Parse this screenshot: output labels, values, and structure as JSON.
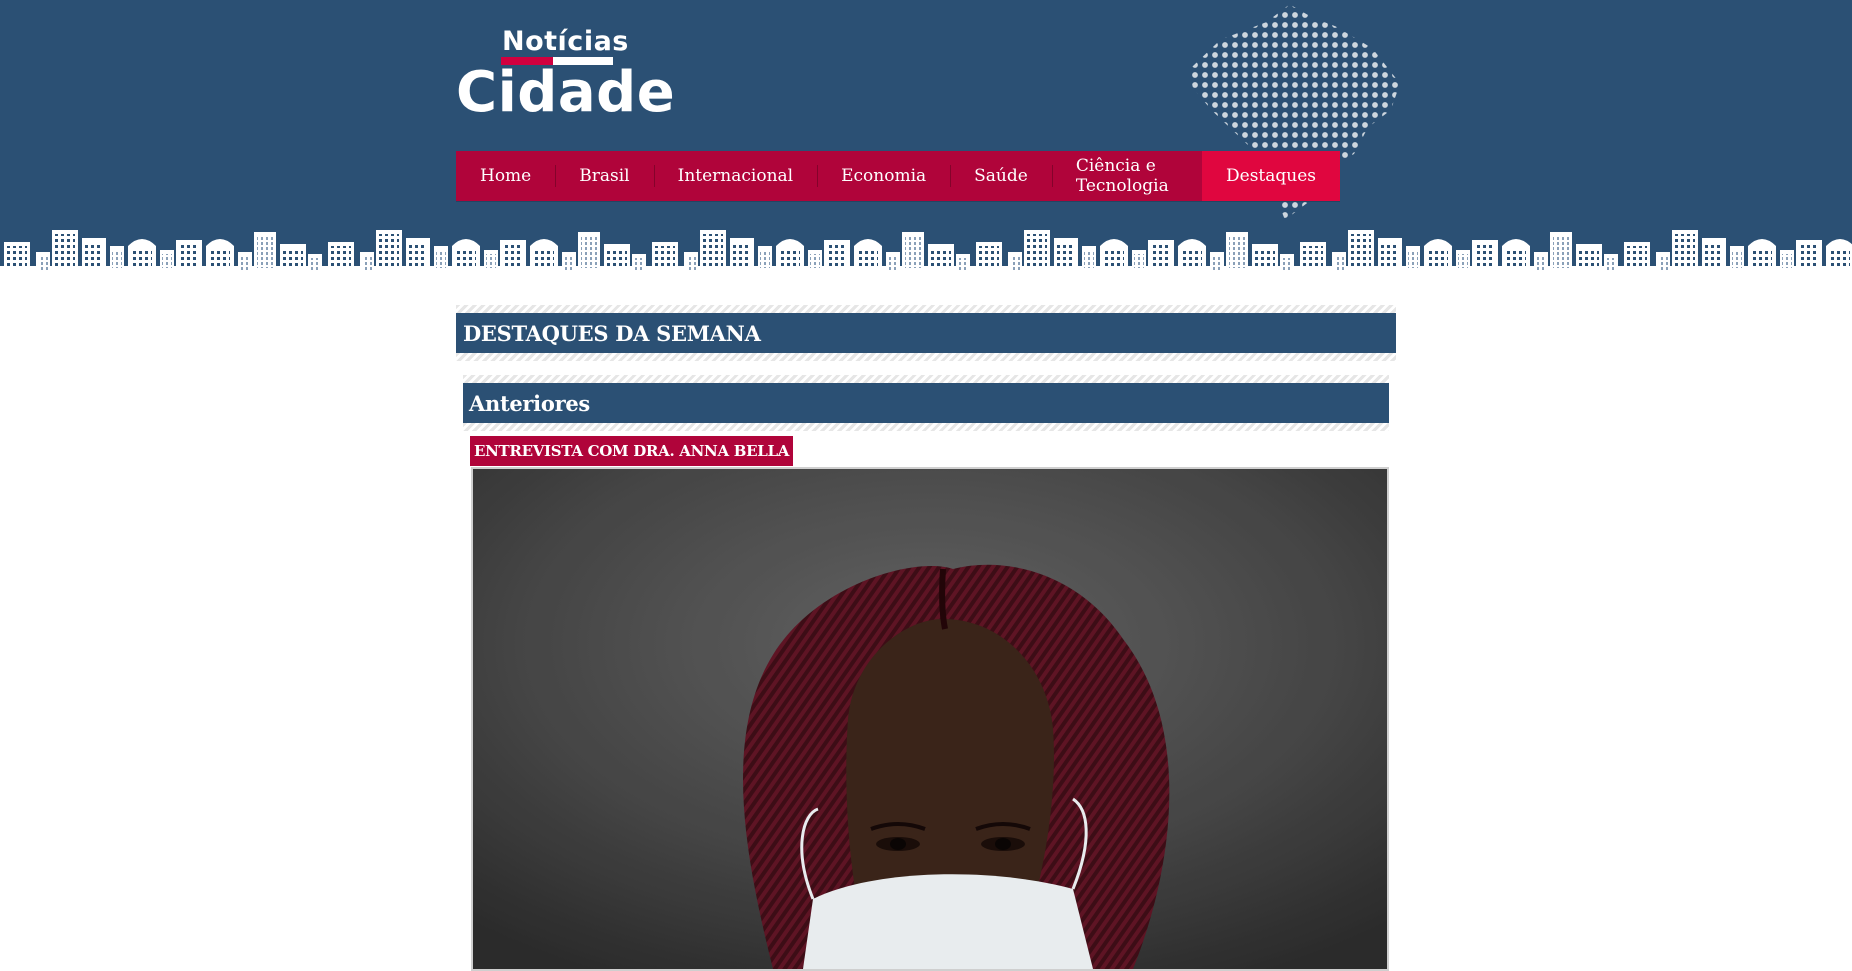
{
  "header": {
    "logo_top": "Notícias",
    "logo_main": "Cidade"
  },
  "nav": {
    "items": [
      {
        "label": "Home"
      },
      {
        "label": "Brasil"
      },
      {
        "label": "Internacional"
      },
      {
        "label": "Economia"
      },
      {
        "label": "Saúde"
      },
      {
        "label": "Ciência e Tecnologia"
      },
      {
        "label": "Destaques"
      }
    ],
    "active": "Destaques"
  },
  "main": {
    "section_title": "DESTAQUES DA SEMANA",
    "subsection_title": "Anteriores",
    "article_tag": "ENTREVISTA COM DRA. ANNA BELLA"
  },
  "colors": {
    "header_bg": "#2b5074",
    "nav_bg": "#b0043a",
    "nav_active": "#e0063f",
    "logo_accent": "#d1003f"
  }
}
